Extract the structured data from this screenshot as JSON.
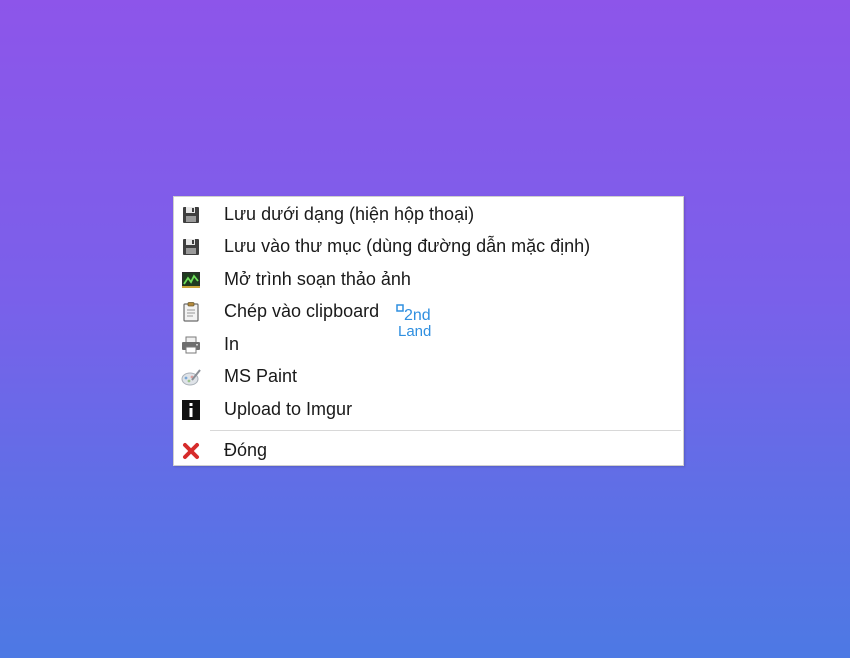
{
  "menu": {
    "items": [
      {
        "label": "Lưu dưới dạng (hiện hộp thoại)",
        "icon": "floppy-disk-icon"
      },
      {
        "label": "Lưu vào thư mục (dùng đường dẫn mặc định)",
        "icon": "floppy-disk-icon"
      },
      {
        "label": "Mở trình soạn thảo ảnh",
        "icon": "image-editor-icon"
      },
      {
        "label": "Chép vào clipboard",
        "icon": "clipboard-icon"
      },
      {
        "label": "In",
        "icon": "printer-icon"
      },
      {
        "label": "MS Paint",
        "icon": "paint-brush-icon"
      },
      {
        "label": "Upload to Imgur",
        "icon": "imgur-info-icon"
      }
    ],
    "close_label": "Đóng",
    "close_icon": "close-x-icon"
  },
  "watermark": {
    "line1": "2nd",
    "line2": "Land",
    "color": "#2f8fe0"
  },
  "colors": {
    "close_red": "#d62b2b",
    "menu_text": "#1a1a1a"
  }
}
